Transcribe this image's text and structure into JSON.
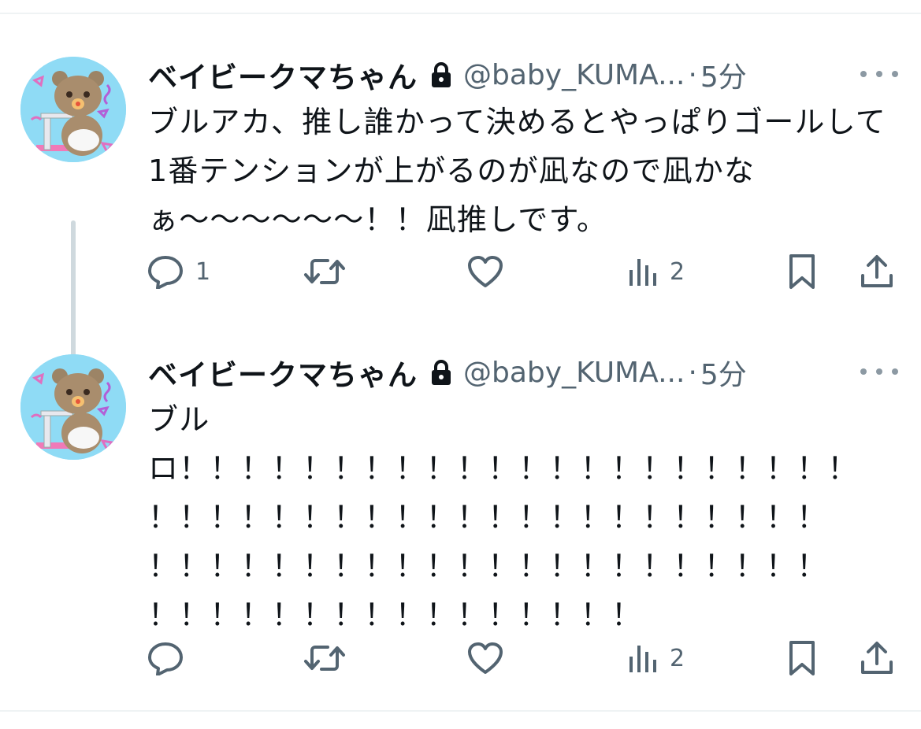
{
  "tweets": [
    {
      "author_name": "ベイビークマちゃん",
      "handle": "@baby_KUMA...",
      "separator": "·",
      "time": "5分",
      "text": "ブルアカ、推し誰かって決めるとやっぱりゴールして1番テンションが上がるのが凪なので凪かなぁ〜〜〜〜〜〜！！凪推しです。",
      "actions": {
        "reply_count": "1",
        "retweet_count": "",
        "like_count": "",
        "views_count": "2"
      },
      "icons": {
        "lock": "lock-icon",
        "more": "more-icon",
        "reply": "reply-icon",
        "retweet": "retweet-icon",
        "like": "heart-icon",
        "views": "views-icon",
        "bookmark": "bookmark-icon",
        "share": "share-icon"
      }
    },
    {
      "author_name": "ベイビークマちゃん",
      "handle": "@baby_KUMA...",
      "separator": "·",
      "time": "5分",
      "text": "ブル\nロ！！！！！！！！！！！！！！！！！！！！！！\n！！！！！！！！！！！！！！！！！！！！！！\n！！！！！！！！！！！！！！！！！！！！！！\n！！！！！！！！！！！！！！！！",
      "actions": {
        "reply_count": "",
        "retweet_count": "",
        "like_count": "",
        "views_count": "2"
      },
      "icons": {
        "lock": "lock-icon",
        "more": "more-icon",
        "reply": "reply-icon",
        "retweet": "retweet-icon",
        "like": "heart-icon",
        "views": "views-icon",
        "bookmark": "bookmark-icon",
        "share": "share-icon"
      }
    }
  ],
  "colors": {
    "text": "#0f1419",
    "secondary": "#536471",
    "thread_line": "#cfd9de",
    "divider": "#eff3f4",
    "avatar_bg": "#8fdbf5"
  }
}
